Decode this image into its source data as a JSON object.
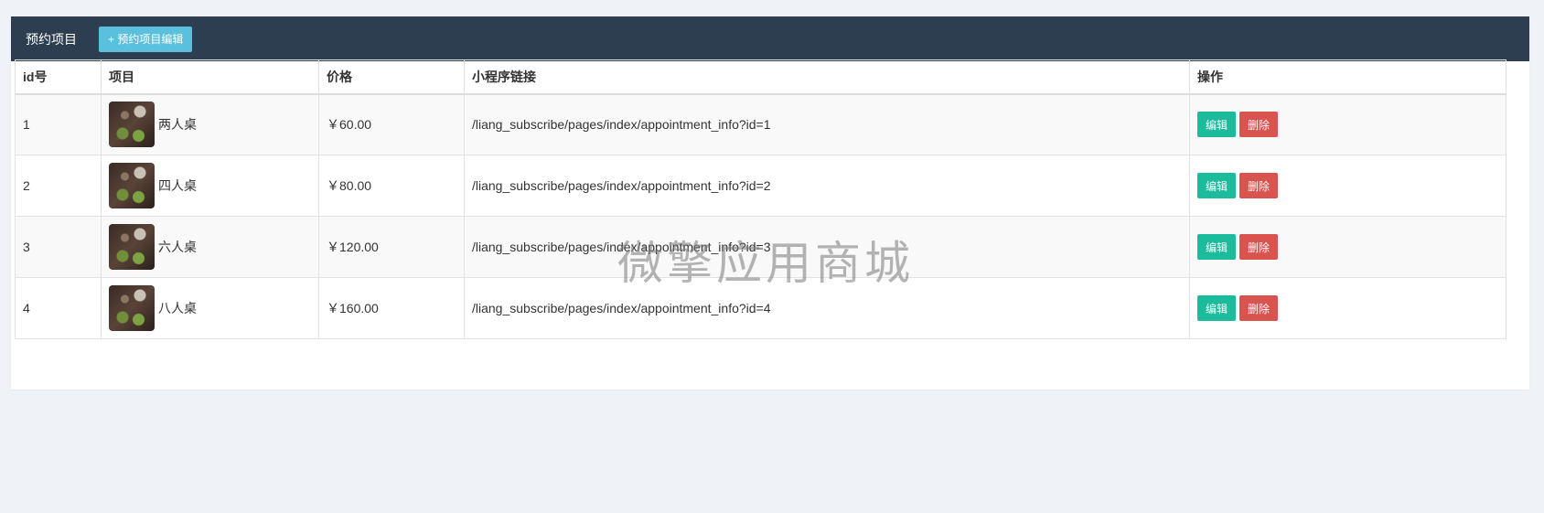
{
  "header": {
    "title": "预约项目",
    "edit_button": "+ 预约项目编辑"
  },
  "table": {
    "columns": [
      "id号",
      "项目",
      "价格",
      "小程序链接",
      "操作"
    ],
    "rows": [
      {
        "id": "1",
        "name": "两人桌",
        "price": "￥60.00",
        "link": "/liang_subscribe/pages/index/appointment_info?id=1"
      },
      {
        "id": "2",
        "name": "四人桌",
        "price": "￥80.00",
        "link": "/liang_subscribe/pages/index/appointment_info?id=2"
      },
      {
        "id": "3",
        "name": "六人桌",
        "price": "￥120.00",
        "link": "/liang_subscribe/pages/index/appointment_info?id=3"
      },
      {
        "id": "4",
        "name": "八人桌",
        "price": "￥160.00",
        "link": "/liang_subscribe/pages/index/appointment_info?id=4"
      }
    ],
    "edit_label": "编辑",
    "delete_label": "删除"
  },
  "watermark": "微擎应用商城",
  "colors": {
    "header_bg": "#2c3e50",
    "info_button": "#5bc0de",
    "edit_button": "#1abc9c",
    "delete_button": "#d9534f",
    "page_bg": "#eff3f7"
  }
}
